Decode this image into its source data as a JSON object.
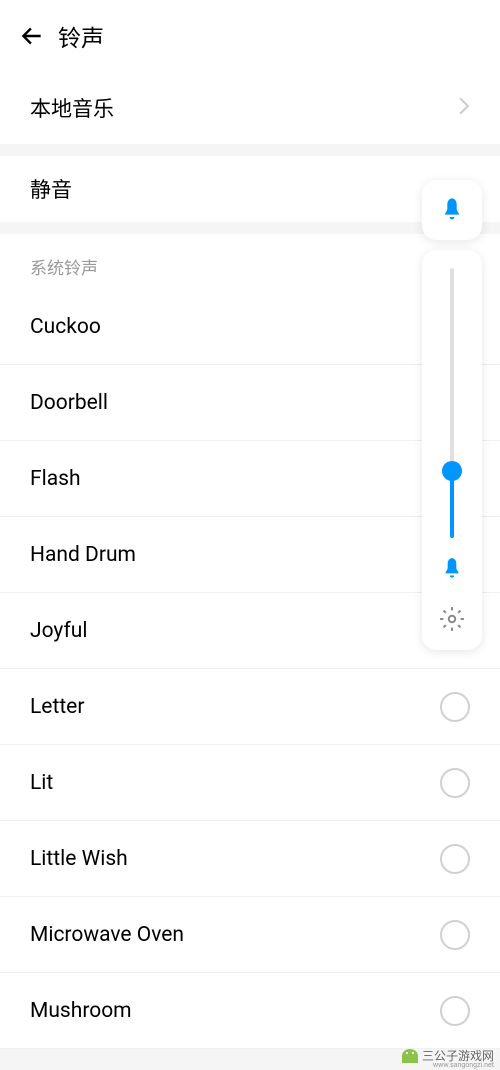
{
  "header": {
    "title": "铃声"
  },
  "local_music": {
    "label": "本地音乐"
  },
  "silent": {
    "label": "静音"
  },
  "system_ringtones": {
    "header": "系统铃声",
    "items": [
      "Cuckoo",
      "Doorbell",
      "Flash",
      "Hand Drum",
      "Joyful",
      "Letter",
      "Lit",
      "Little Wish",
      "Microwave Oven",
      "Mushroom"
    ]
  },
  "volume": {
    "level_percent": 25
  },
  "watermark": {
    "text": "三公子游戏网",
    "url": "www.sangongzi.net"
  }
}
